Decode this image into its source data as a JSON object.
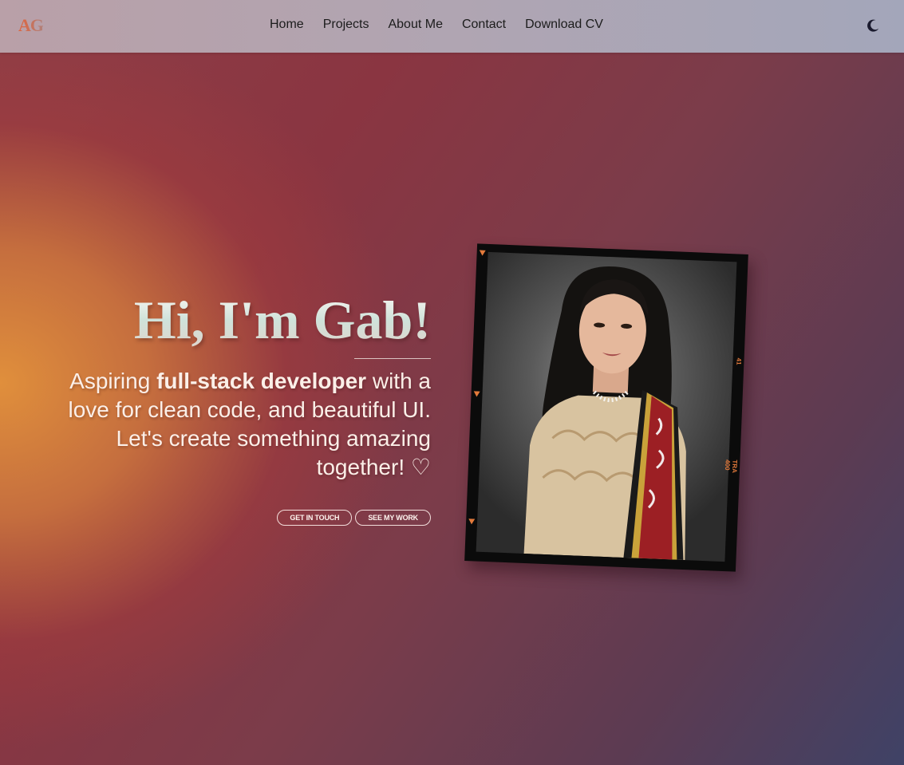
{
  "nav": {
    "logo": "AG",
    "links": [
      "Home",
      "Projects",
      "About Me",
      "Contact",
      "Download CV"
    ],
    "theme_icon": "moon-icon"
  },
  "hero": {
    "title": "Hi, I'm Gab!",
    "subtitle_prefix": "Aspiring ",
    "subtitle_bold": "full-stack developer",
    "subtitle_rest": " with a love for clean code, and beautiful UI. Let's create something amazing together! ",
    "heart": "♡",
    "buttons": {
      "primary": "GET IN TOUCH",
      "secondary": "SEE MY WORK"
    }
  },
  "photo": {
    "film_label": "TRA 400",
    "frame_number": "41",
    "alt": "portrait-photo"
  },
  "colors": {
    "accent_orange": "#e0633a",
    "navbar_bg": "#b0a5b2",
    "text_light": "#fbefe8"
  }
}
